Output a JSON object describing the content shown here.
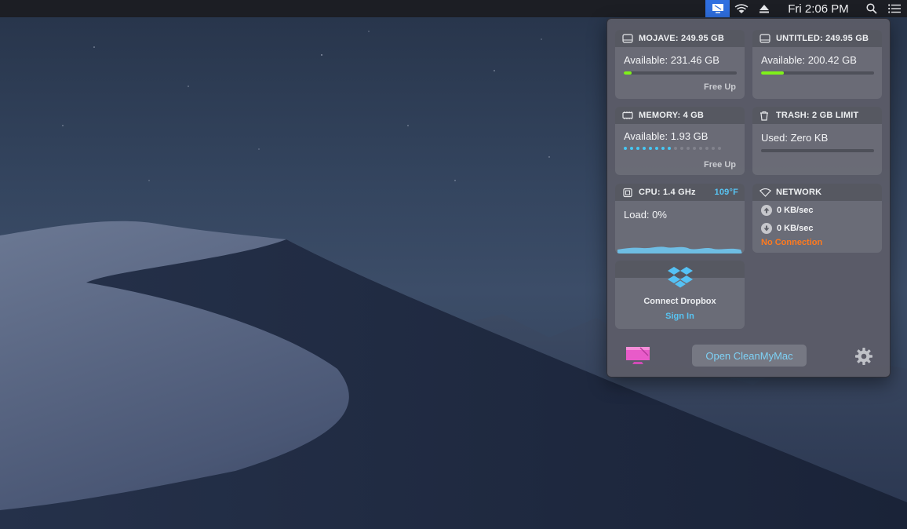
{
  "menubar": {
    "clock": "Fri 2:06 PM",
    "icons": [
      "cleanmymac-menu-icon",
      "wifi-icon",
      "eject-icon",
      "search-icon",
      "notification-list-icon"
    ]
  },
  "widgets": {
    "mojave": {
      "title": "MOJAVE: 249.95 GB",
      "line": "Available: 231.46 GB",
      "used_fraction": 0.07,
      "action": "Free Up"
    },
    "untitled": {
      "title": "UNTITLED: 249.95 GB",
      "line": "Available: 200.42 GB",
      "used_fraction": 0.2,
      "action": ""
    },
    "memory": {
      "title": "MEMORY: 4 GB",
      "line": "Available: 1.93 GB",
      "dots_total": 16,
      "dots_on": 8,
      "action": "Free Up"
    },
    "trash": {
      "title": "TRASH: 2 GB LIMIT",
      "line": "Used: Zero KB",
      "used_fraction": 0
    },
    "cpu": {
      "title": "CPU: 1.4 GHz",
      "temp": "109°F",
      "line": "Load: 0%"
    },
    "network": {
      "title": "NETWORK",
      "upload": "0 KB/sec",
      "download": "0 KB/sec",
      "status": "No Connection"
    },
    "dropbox": {
      "title": "Connect Dropbox",
      "action": "Sign In"
    }
  },
  "footer": {
    "open_button": "Open CleanMyMac"
  },
  "colors": {
    "accent_blue": "#58c4f2",
    "bar_green": "#7ff11a",
    "warning_orange": "#ff7a1f",
    "menubar_highlight": "#2f6fe0"
  }
}
